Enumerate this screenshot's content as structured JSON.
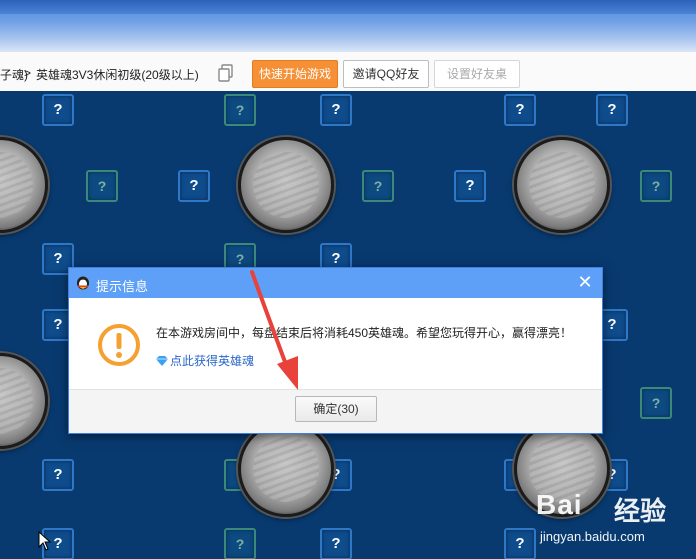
{
  "toolbar": {
    "breadcrumb_prev": "子魂)",
    "breadcrumb_sep": ">",
    "breadcrumb_current": "英雄魂3V3休闲初级(20级以上)",
    "quick_start_label": "快速开始游戏",
    "invite_label": "邀请QQ好友",
    "settings_label": "设置好友桌"
  },
  "game": {
    "seat_symbol": "?"
  },
  "dialog": {
    "title": "提示信息",
    "close_symbol": "✕",
    "message": "在本游戏房间中，每盘结束后将消耗450英雄魂。希望您玩得开心，赢得漂亮！",
    "link_text": "点此获得英雄魂",
    "ok_label": "确定(30)"
  },
  "watermark": {
    "brand_a": "Bai",
    "brand_b": "经验",
    "url": "jingyan.baidu.com"
  },
  "colors": {
    "accent_orange": "#f59036",
    "dialog_title": "#5ea0f7",
    "game_bg": "#083a70",
    "arrow": "#e8423a"
  },
  "icons": [
    "copy-icon",
    "qq-penguin-icon",
    "close-icon",
    "warning-icon",
    "diamond-icon",
    "arrow-annotation",
    "mouse-cursor-icon"
  ]
}
